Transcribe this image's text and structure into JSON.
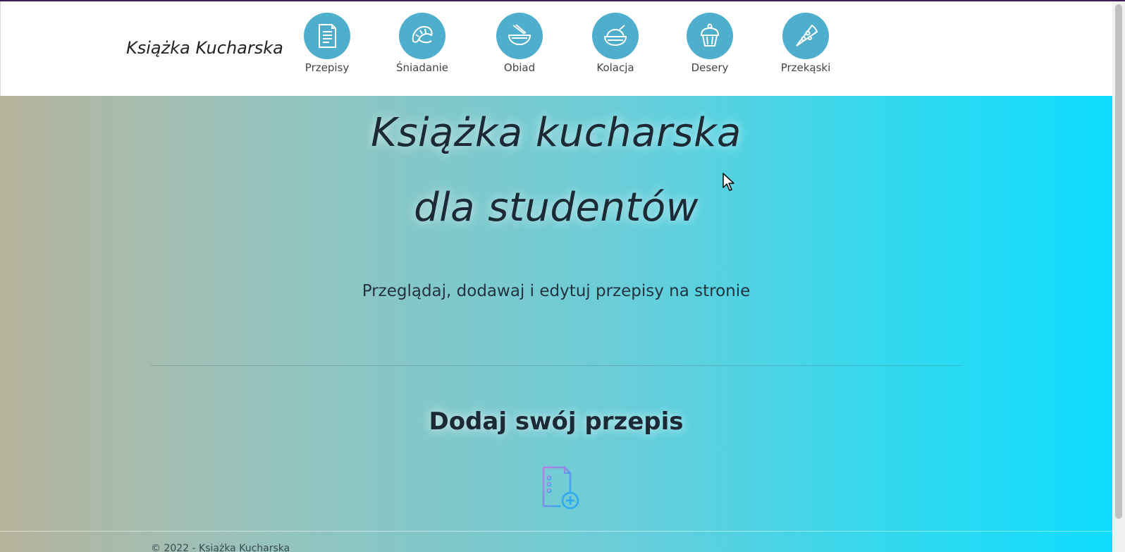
{
  "brand": "Książka Kucharska",
  "nav": [
    {
      "label": "Przepisy",
      "icon": "document-icon"
    },
    {
      "label": "Śniadanie",
      "icon": "croissant-icon"
    },
    {
      "label": "Obiad",
      "icon": "noodle-bowl-icon"
    },
    {
      "label": "Kolacja",
      "icon": "rice-bowl-icon"
    },
    {
      "label": "Desery",
      "icon": "cupcake-icon"
    },
    {
      "label": "Przekąski",
      "icon": "pizza-slice-icon"
    }
  ],
  "hero": {
    "title_line1": "Książka kucharska",
    "title_line2": "dla studentów",
    "subtitle": "Przeglądaj, dodawaj i edytuj przepisy na stronie",
    "add_heading": "Dodaj swój przepis",
    "add_icon": "add-recipe-icon"
  },
  "footer": {
    "text": "© 2022 - Książka Kucharska"
  },
  "colors": {
    "nav_circle": "#4eaecb",
    "gradient_left": "#b7b49c",
    "gradient_right": "#0fdcff",
    "text_dark": "#1c2a36"
  }
}
